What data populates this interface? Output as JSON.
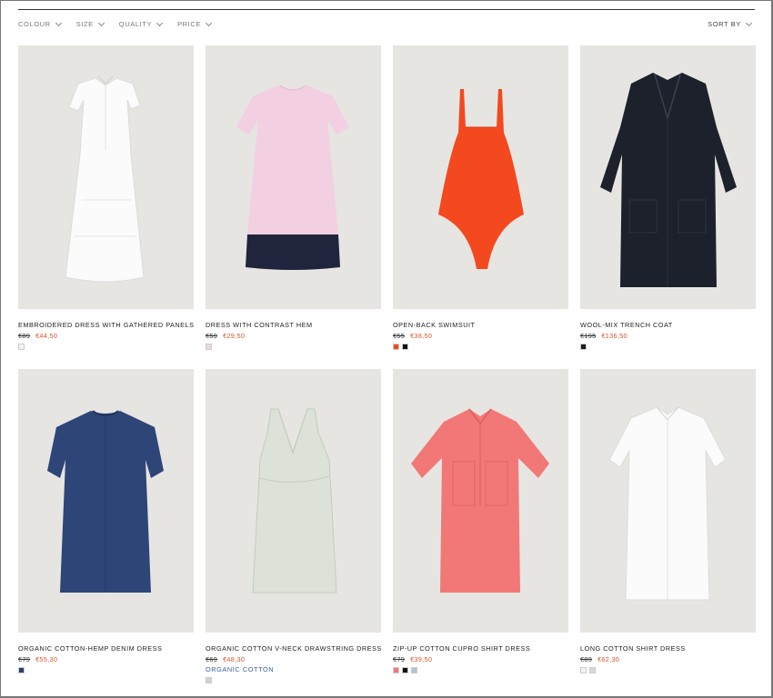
{
  "filters": [
    {
      "label": "COLOUR"
    },
    {
      "label": "SIZE"
    },
    {
      "label": "QUALITY"
    },
    {
      "label": "PRICE"
    }
  ],
  "sort_label": "SORT BY",
  "products": [
    {
      "name": "EMBROIDERED DRESS WITH GATHERED PANELS",
      "old_price": "€89",
      "new_price": "€44,50",
      "tag": "",
      "garment": "white tiered dress",
      "colors": [
        "#f2f2f2"
      ]
    },
    {
      "name": "DRESS WITH CONTRAST HEM",
      "old_price": "€59",
      "new_price": "€29,50",
      "tag": "",
      "garment": "pink dress navy hem",
      "colors": [
        "#f0d6e4"
      ]
    },
    {
      "name": "OPEN-BACK SWIMSUIT",
      "old_price": "€55",
      "new_price": "€38,50",
      "tag": "",
      "garment": "orange swimsuit",
      "colors": [
        "#f04a1c",
        "#111111"
      ]
    },
    {
      "name": "WOOL-MIX TRENCH COAT",
      "old_price": "€195",
      "new_price": "€136,50",
      "tag": "",
      "garment": "navy trench coat",
      "colors": [
        "#1a1e26"
      ]
    },
    {
      "name": "ORGANIC COTTON-HEMP DENIM DRESS",
      "old_price": "€79",
      "new_price": "€55,30",
      "tag": "",
      "garment": "denim dress",
      "colors": [
        "#2a3f6e"
      ]
    },
    {
      "name": "ORGANIC COTTON V-NECK DRAWSTRING DRESS",
      "old_price": "€69",
      "new_price": "€48,30",
      "tag": "ORGANIC COTTON",
      "garment": "mint v-neck dress",
      "colors": [
        "#cfd3cc"
      ]
    },
    {
      "name": "ZIP-UP COTTON CUPRO SHIRT DRESS",
      "old_price": "€79",
      "new_price": "€39,50",
      "tag": "",
      "garment": "coral shirt dress",
      "colors": [
        "#ef7a7a",
        "#111111",
        "#a9c4d8"
      ]
    },
    {
      "name": "LONG COTTON SHIRT DRESS",
      "old_price": "€89",
      "new_price": "€62,30",
      "tag": "",
      "garment": "white shirt dress",
      "colors": [
        "#f2f2f2",
        "#d8d8d8"
      ]
    }
  ]
}
